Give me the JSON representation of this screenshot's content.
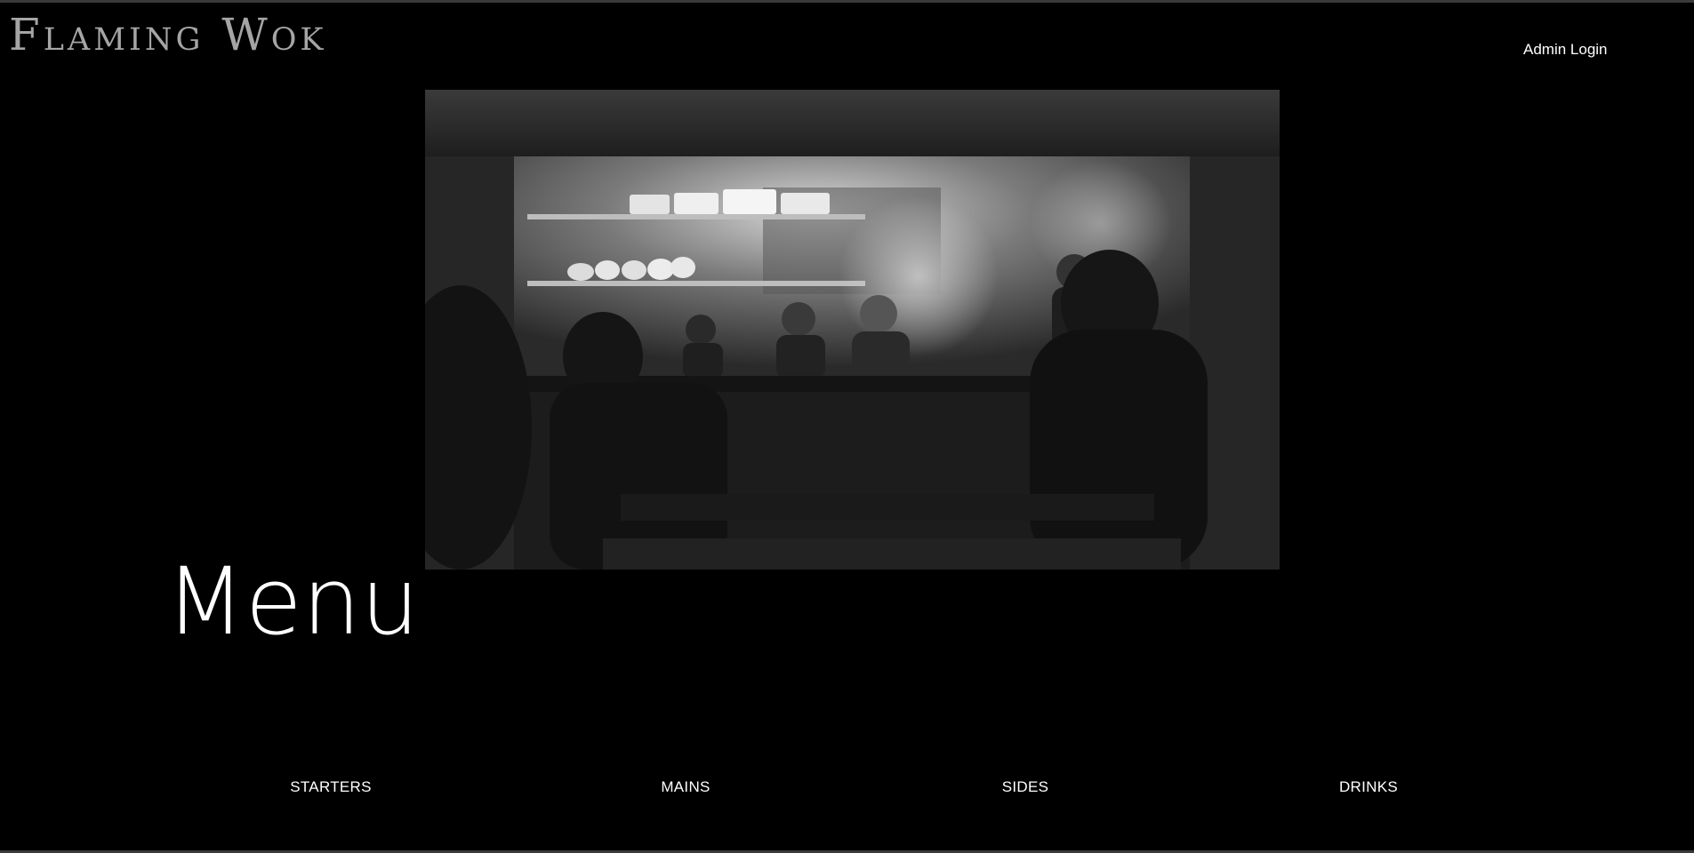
{
  "header": {
    "brand": "Flaming Wok",
    "admin_login": "Admin Login"
  },
  "hero": {
    "alt": "Restaurant kitchen pass with chefs cooking amid steam, diners in foreground (black and white photo)"
  },
  "main": {
    "title": "Menu"
  },
  "menu_categories": [
    {
      "label": "STARTERS"
    },
    {
      "label": "MAINS"
    },
    {
      "label": "SIDES"
    },
    {
      "label": "DRINKS"
    }
  ],
  "colors": {
    "background": "#000000",
    "brand_text": "#a5a5a5",
    "text": "#ffffff"
  }
}
